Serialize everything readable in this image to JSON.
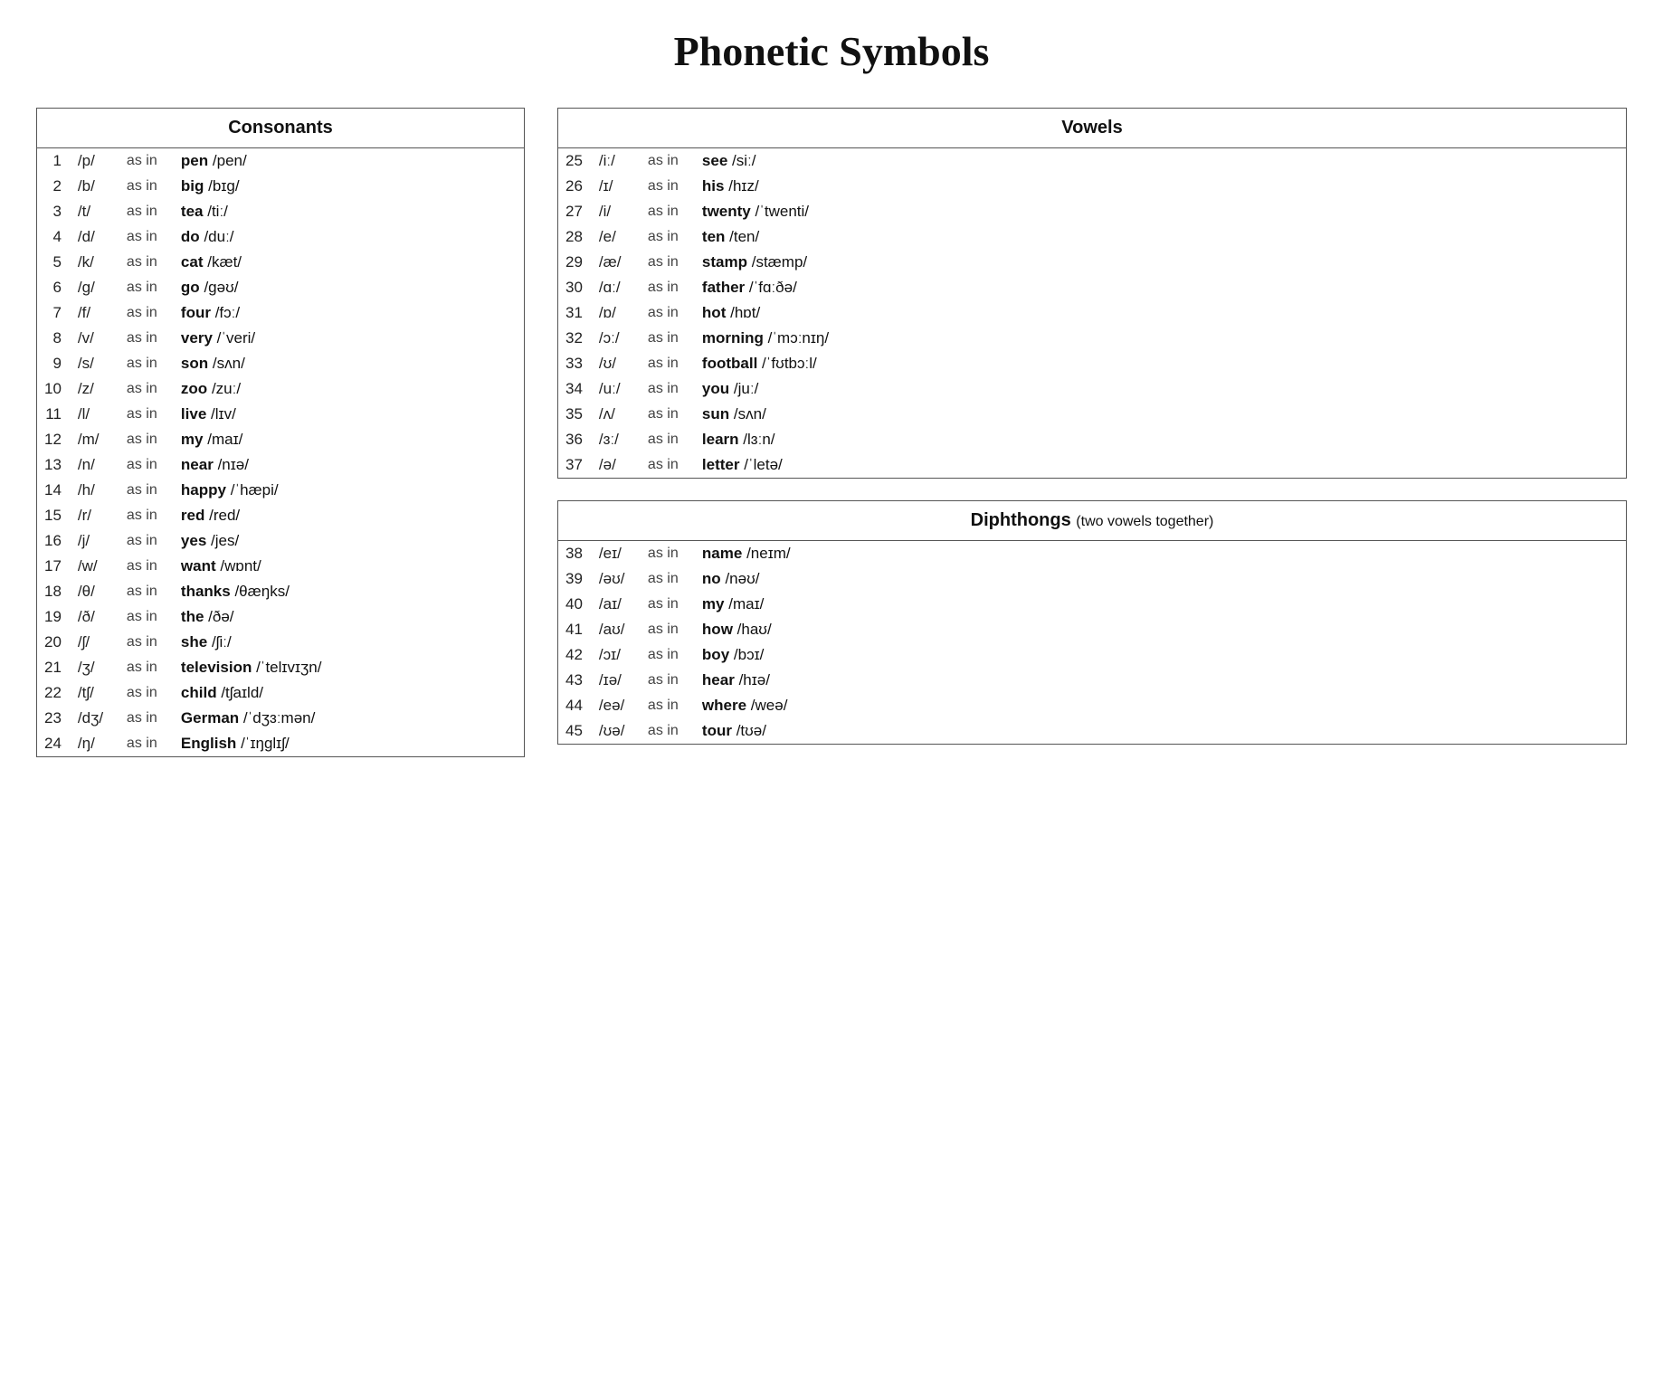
{
  "title": "Phonetic Symbols",
  "consonants": {
    "header": "Consonants",
    "rows": [
      {
        "num": 1,
        "ipa": "/p/",
        "asin": "as in",
        "word": "pen",
        "pron": "/pen/"
      },
      {
        "num": 2,
        "ipa": "/b/",
        "asin": "as in",
        "word": "big",
        "pron": "/bɪg/"
      },
      {
        "num": 3,
        "ipa": "/t/",
        "asin": "as in",
        "word": "tea",
        "pron": "/tiː/"
      },
      {
        "num": 4,
        "ipa": "/d/",
        "asin": "as in",
        "word": "do",
        "pron": "/duː/"
      },
      {
        "num": 5,
        "ipa": "/k/",
        "asin": "as in",
        "word": "cat",
        "pron": "/kæt/"
      },
      {
        "num": 6,
        "ipa": "/g/",
        "asin": "as in",
        "word": "go",
        "pron": "/gəʊ/"
      },
      {
        "num": 7,
        "ipa": "/f/",
        "asin": "as in",
        "word": "four",
        "pron": "/fɔː/"
      },
      {
        "num": 8,
        "ipa": "/v/",
        "asin": "as in",
        "word": "very",
        "pron": "/ˈveri/"
      },
      {
        "num": 9,
        "ipa": "/s/",
        "asin": "as in",
        "word": "son",
        "pron": "/sʌn/"
      },
      {
        "num": 10,
        "ipa": "/z/",
        "asin": "as in",
        "word": "zoo",
        "pron": "/zuː/"
      },
      {
        "num": 11,
        "ipa": "/l/",
        "asin": "as in",
        "word": "live",
        "pron": "/lɪv/"
      },
      {
        "num": 12,
        "ipa": "/m/",
        "asin": "as in",
        "word": "my",
        "pron": "/maɪ/"
      },
      {
        "num": 13,
        "ipa": "/n/",
        "asin": "as in",
        "word": "near",
        "pron": "/nɪə/"
      },
      {
        "num": 14,
        "ipa": "/h/",
        "asin": "as in",
        "word": "happy",
        "pron": "/ˈhæpi/"
      },
      {
        "num": 15,
        "ipa": "/r/",
        "asin": "as in",
        "word": "red",
        "pron": "/red/"
      },
      {
        "num": 16,
        "ipa": "/j/",
        "asin": "as in",
        "word": "yes",
        "pron": "/jes/"
      },
      {
        "num": 17,
        "ipa": "/w/",
        "asin": "as in",
        "word": "want",
        "pron": "/wɒnt/"
      },
      {
        "num": 18,
        "ipa": "/θ/",
        "asin": "as in",
        "word": "thanks",
        "pron": "/θæŋks/"
      },
      {
        "num": 19,
        "ipa": "/ð/",
        "asin": "as in",
        "word": "the",
        "pron": "/ðə/"
      },
      {
        "num": 20,
        "ipa": "/ʃ/",
        "asin": "as in",
        "word": "she",
        "pron": "/ʃiː/"
      },
      {
        "num": 21,
        "ipa": "/ʒ/",
        "asin": "as in",
        "word": "television",
        "pron": "/ˈtelɪvɪʒn/"
      },
      {
        "num": 22,
        "ipa": "/tʃ/",
        "asin": "as in",
        "word": "child",
        "pron": "/tʃaɪld/"
      },
      {
        "num": 23,
        "ipa": "/dʒ/",
        "asin": "as in",
        "word": "German",
        "pron": "/ˈdʒɜːmən/"
      },
      {
        "num": 24,
        "ipa": "/ŋ/",
        "asin": "as in",
        "word": "English",
        "pron": "/ˈɪŋglɪʃ/"
      }
    ]
  },
  "vowels": {
    "header": "Vowels",
    "rows": [
      {
        "num": 25,
        "ipa": "/iː/",
        "asin": "as in",
        "word": "see",
        "pron": "/siː/"
      },
      {
        "num": 26,
        "ipa": "/ɪ/",
        "asin": "as in",
        "word": "his",
        "pron": "/hɪz/"
      },
      {
        "num": 27,
        "ipa": "/i/",
        "asin": "as in",
        "word": "twenty",
        "pron": "/ˈtwenti/"
      },
      {
        "num": 28,
        "ipa": "/e/",
        "asin": "as in",
        "word": "ten",
        "pron": "/ten/"
      },
      {
        "num": 29,
        "ipa": "/æ/",
        "asin": "as in",
        "word": "stamp",
        "pron": "/stæmp/"
      },
      {
        "num": 30,
        "ipa": "/ɑː/",
        "asin": "as in",
        "word": "father",
        "pron": "/ˈfɑːðə/"
      },
      {
        "num": 31,
        "ipa": "/ɒ/",
        "asin": "as in",
        "word": "hot",
        "pron": "/hɒt/"
      },
      {
        "num": 32,
        "ipa": "/ɔː/",
        "asin": "as in",
        "word": "morning",
        "pron": "/ˈmɔːnɪŋ/"
      },
      {
        "num": 33,
        "ipa": "/ʊ/",
        "asin": "as in",
        "word": "football",
        "pron": "/ˈfʊtbɔːl/"
      },
      {
        "num": 34,
        "ipa": "/uː/",
        "asin": "as in",
        "word": "you",
        "pron": "/juː/"
      },
      {
        "num": 35,
        "ipa": "/ʌ/",
        "asin": "as in",
        "word": "sun",
        "pron": "/sʌn/"
      },
      {
        "num": 36,
        "ipa": "/ɜː/",
        "asin": "as in",
        "word": "learn",
        "pron": "/lɜːn/"
      },
      {
        "num": 37,
        "ipa": "/ə/",
        "asin": "as in",
        "word": "letter",
        "pron": "/ˈletə/"
      }
    ]
  },
  "diphthongs": {
    "header": "Diphthongs",
    "subtitle": "(two vowels together)",
    "rows": [
      {
        "num": 38,
        "ipa": "/eɪ/",
        "asin": "as in",
        "word": "name",
        "pron": "/neɪm/"
      },
      {
        "num": 39,
        "ipa": "/əʊ/",
        "asin": "as in",
        "word": "no",
        "pron": "/nəʊ/"
      },
      {
        "num": 40,
        "ipa": "/aɪ/",
        "asin": "as in",
        "word": "my",
        "pron": "/maɪ/"
      },
      {
        "num": 41,
        "ipa": "/aʊ/",
        "asin": "as in",
        "word": "how",
        "pron": "/haʊ/"
      },
      {
        "num": 42,
        "ipa": "/ɔɪ/",
        "asin": "as in",
        "word": "boy",
        "pron": "/bɔɪ/"
      },
      {
        "num": 43,
        "ipa": "/ɪə/",
        "asin": "as in",
        "word": "hear",
        "pron": "/hɪə/"
      },
      {
        "num": 44,
        "ipa": "/eə/",
        "asin": "as in",
        "word": "where",
        "pron": "/weə/"
      },
      {
        "num": 45,
        "ipa": "/ʊə/",
        "asin": "as in",
        "word": "tour",
        "pron": "/tʊə/"
      }
    ]
  }
}
